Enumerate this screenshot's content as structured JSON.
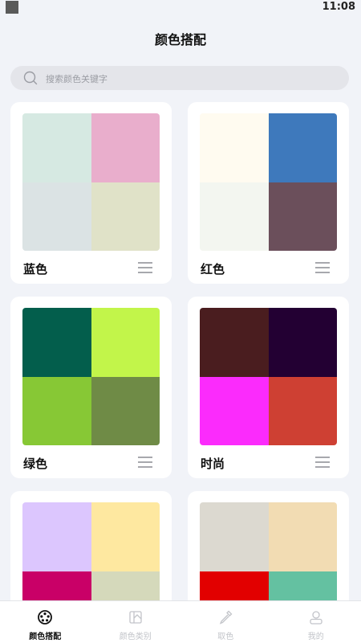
{
  "status_bar": {
    "time": "11:08"
  },
  "header": {
    "title": "颜色搭配"
  },
  "search": {
    "placeholder": "搜索颜色关键字",
    "value": ""
  },
  "cards": [
    {
      "name": "蓝色",
      "colors": [
        "#d6e9e2",
        "#e9aecc",
        "#dbe3e4",
        "#e0e2c8"
      ]
    },
    {
      "name": "红色",
      "colors": [
        "#fffbf0",
        "#3e79bc",
        "#f3f6f0",
        "#6b4f5b"
      ]
    },
    {
      "name": "绿色",
      "colors": [
        "#035e4c",
        "#c2f54a",
        "#87c835",
        "#6f8b46"
      ]
    },
    {
      "name": "时尚",
      "colors": [
        "#4a1d1f",
        "#230033",
        "#fb2bfc",
        "#ce4033"
      ]
    },
    {
      "name": "",
      "colors": [
        "#dcc6fe",
        "#fee8a0",
        "#c90067",
        "#d5d9bb"
      ]
    },
    {
      "name": "",
      "colors": [
        "#dcd9d0",
        "#f2dcb3",
        "#e20000",
        "#64c1a1"
      ]
    }
  ],
  "tabs": [
    {
      "label": "颜色搭配",
      "icon": "palette-icon",
      "active": true
    },
    {
      "label": "颜色类别",
      "icon": "category-icon",
      "active": false
    },
    {
      "label": "取色",
      "icon": "eyedropper-icon",
      "active": false
    },
    {
      "label": "我的",
      "icon": "profile-icon",
      "active": false
    }
  ]
}
